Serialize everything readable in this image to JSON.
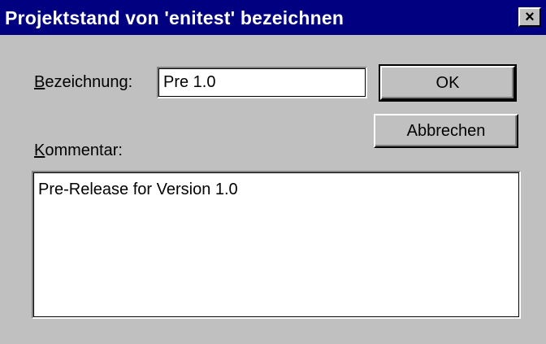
{
  "window": {
    "title": "Projektstand von 'enitest' bezeichnen",
    "close_glyph": "×"
  },
  "form": {
    "bezeichnung_label_mnemonic": "B",
    "bezeichnung_label_rest": "ezeichnung:",
    "bezeichnung_value": "Pre 1.0",
    "kommentar_label_mnemonic": "K",
    "kommentar_label_rest": "ommentar:",
    "kommentar_value": "Pre-Release for Version 1.0"
  },
  "buttons": {
    "ok_label": "OK",
    "cancel_label": "Abbrechen"
  },
  "colors": {
    "titlebar": "#000080",
    "face": "#c0c0c0",
    "field": "#ffffff"
  },
  "icons": {
    "close": "close-icon"
  }
}
